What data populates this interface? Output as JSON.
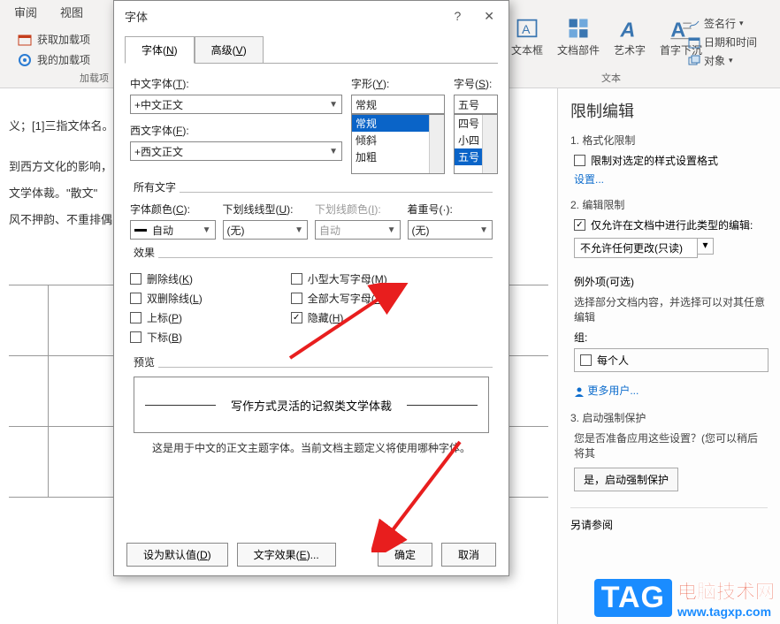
{
  "ribbon": {
    "tabs": [
      "审阅",
      "视图"
    ],
    "get_addins": "获取加载项",
    "my_addins": "我的加载项",
    "group_addins": "加载项",
    "textbox": "文本框",
    "parts": "文档部件",
    "wordart": "艺术字",
    "dropcap": "首字下沉",
    "sigline": "签名行",
    "datetime": "日期和时间",
    "object": "对象",
    "group_text": "文本"
  },
  "doc": {
    "line1": "义；[1]三指文体名。",
    "line2": "到西方文化的影响，",
    "line3": "文学体裁。\"散文\"",
    "line4": "风不押韵、不重排偶"
  },
  "dialog": {
    "title": "字体",
    "tabs": {
      "font": "字体(N)",
      "adv": "高级(V)"
    },
    "zh_label": "中文字体(T):",
    "zh_value": "+中文正文",
    "west_label": "西文字体(F):",
    "west_value": "+西文正文",
    "style_label": "字形(Y):",
    "style_value": "常规",
    "style_list": [
      "常规",
      "倾斜",
      "加粗"
    ],
    "size_label": "字号(S):",
    "size_value": "五号",
    "size_list": [
      "四号",
      "小四",
      "五号"
    ],
    "all_text": "所有文字",
    "color_label": "字体颜色(C):",
    "color_value": "自动",
    "ul_style_label": "下划线线型(U):",
    "ul_style_value": "(无)",
    "ul_color_label": "下划线颜色(I):",
    "ul_color_value": "自动",
    "emph_label": "着重号(·):",
    "emph_value": "(无)",
    "effects": "效果",
    "strike": "删除线(K)",
    "dstrike": "双删除线(L)",
    "sup": "上标(P)",
    "sub": "下标(B)",
    "smallcaps": "小型大写字母(M)",
    "allcaps": "全部大写字母(A)",
    "hidden": "隐藏(H)",
    "preview": "预览",
    "preview_text": "写作方式灵活的记叙类文学体裁",
    "preview_note": "这是用于中文的正文主题字体。当前文档主题定义将使用哪种字体。",
    "set_default": "设为默认值(D)",
    "text_effects": "文字效果(E)...",
    "ok": "确定",
    "cancel": "取消"
  },
  "pane": {
    "title": "限制编辑",
    "s1": "1. 格式化限制",
    "s1_check": "限制对选定的样式设置格式",
    "s1_link": "设置...",
    "s2": "2. 编辑限制",
    "s2_check": "仅允许在文档中进行此类型的编辑:",
    "s2_select": "不允许任何更改(只读)",
    "exc": "例外项(可选)",
    "exc_desc": "选择部分文档内容，并选择可以对其任意编辑",
    "exc_group": "组:",
    "exc_everyone": "每个人",
    "more_users": "更多用户...",
    "s3": "3. 启动强制保护",
    "s3_desc": "您是否准备应用这些设置？(您可以稍后将其",
    "s3_btn": "是，启动强制保护",
    "see_also": "另请参阅"
  },
  "watermark": {
    "tag": "TAG",
    "t1": "电脑技术网",
    "t2": "www.tagxp.com"
  }
}
